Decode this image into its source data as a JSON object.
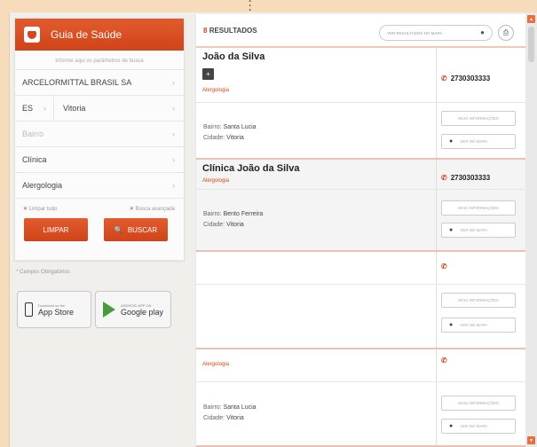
{
  "left": {
    "title": "Guia de Saúde",
    "hint": "Informe aqui os parâmetros de busca",
    "operator": "ARCELORMITTAL BRASIL SA",
    "uf": "ES",
    "city": "Vitoria",
    "bairro_placeholder": "Bairro",
    "type": "Clínica",
    "specialty": "Alergologia",
    "opt_left": "Limpar tudo",
    "opt_right": "Busca avançada",
    "btn_clear": "LIMPAR",
    "btn_search": "BUSCAR",
    "note": "* Campos Obrigatórios"
  },
  "stores": {
    "apple_small": "Download on the",
    "apple_big": "App Store",
    "google_small": "ANDROID APP ON",
    "google_big": "Google play"
  },
  "results": {
    "count_num": "8",
    "count_label": "RESULTADOS",
    "map_button": "VER RESULTADOS NO MAPA",
    "cards": [
      {
        "name": "João da Silva",
        "specialty": "Alergologia",
        "phone": "2730303333",
        "bairro_label": "Bairro:",
        "bairro": "Santa Lucia",
        "cidade_label": "Cidade:",
        "cidade": "Vitoria",
        "more_info": "MAIS INFORMAÇÕES",
        "map": "VER NO MAPA"
      },
      {
        "name": "Clínica João da Silva",
        "specialty": "Alergologia",
        "phone": "2730303333",
        "bairro_label": "Bairro:",
        "bairro": "Bento Ferreira",
        "cidade_label": "Cidade:",
        "cidade": "Vitoria",
        "more_info": "MAIS INFORMAÇÕES",
        "map": "VER NO MAPA"
      },
      {
        "more_info": "MAIS INFORMAÇÕES",
        "map": "VER NO MAPA"
      },
      {
        "specialty": "Alergologia",
        "bairro_label": "Bairro:",
        "bairro": "Santa Lucia",
        "cidade_label": "Cidade:",
        "cidade": "Vitoria",
        "more_info": "MAIS INFORMAÇÕES",
        "map": "VER NO MAPA"
      }
    ]
  },
  "colors": {
    "accent": "#d9461b",
    "background": "#f6dcbb"
  }
}
